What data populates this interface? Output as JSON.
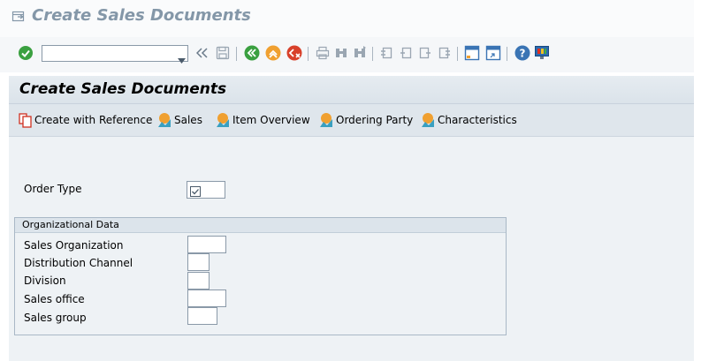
{
  "window": {
    "title": "Create Sales Documents"
  },
  "toolbar": {
    "command_field_value": "",
    "icons": [
      "enter-icon",
      "command-dropdown-icon",
      "collapse-icon",
      "save-icon",
      "back-icon",
      "exit-icon",
      "cancel-icon",
      "print-icon",
      "find-icon",
      "find-next-icon",
      "first-page-icon",
      "previous-page-icon",
      "next-page-icon",
      "last-page-icon",
      "create-session-icon",
      "shortcut-icon",
      "help-icon",
      "layout-menu-icon"
    ]
  },
  "page": {
    "title": "Create Sales Documents"
  },
  "app_toolbar": {
    "create_with_reference": "Create with Reference",
    "sales": "Sales",
    "item_overview": "Item Overview",
    "ordering_party": "Ordering Party",
    "characteristics": "Characteristics"
  },
  "form": {
    "order_type": {
      "label": "Order Type",
      "value": "",
      "required": true
    },
    "org_group_title": "Organizational Data",
    "sales_organization": {
      "label": "Sales Organization",
      "value": ""
    },
    "distribution_channel": {
      "label": "Distribution Channel",
      "value": ""
    },
    "division": {
      "label": "Division",
      "value": ""
    },
    "sales_office": {
      "label": "Sales office",
      "value": ""
    },
    "sales_group": {
      "label": "Sales group",
      "value": ""
    }
  },
  "colors": {
    "title_text": "#8497a8",
    "toolbar_bg": "#f5f7f9",
    "container_bg": "#e9eef2",
    "accent_orange": "#f0a030",
    "green": "#3aa040"
  }
}
